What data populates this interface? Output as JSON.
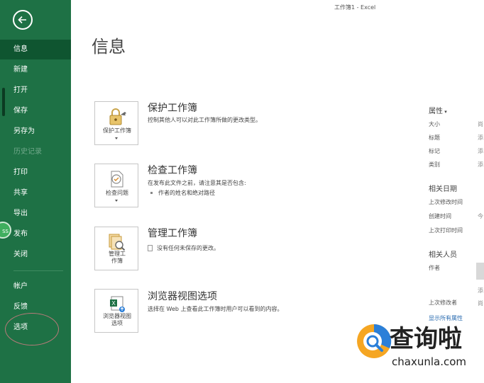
{
  "window": {
    "title": "工作簿1 - Excel"
  },
  "sidebar": {
    "items": [
      {
        "label": "信息"
      },
      {
        "label": "新建"
      },
      {
        "label": "打开"
      },
      {
        "label": "保存"
      },
      {
        "label": "另存为"
      },
      {
        "label": "历史记录"
      },
      {
        "label": "打印"
      },
      {
        "label": "共享"
      },
      {
        "label": "导出"
      },
      {
        "label": "发布"
      },
      {
        "label": "关闭"
      },
      {
        "label": "帐户"
      },
      {
        "label": "反馈"
      },
      {
        "label": "选项"
      }
    ],
    "selected": "信息",
    "disabled": "历史记录",
    "badge_text": "SS"
  },
  "page": {
    "title": "信息"
  },
  "sections": {
    "protect": {
      "button": "保护工作簿",
      "title": "保护工作簿",
      "desc": "控制其他人可以对此工作簿所做的更改类型。"
    },
    "inspect": {
      "button": "检查问题",
      "title": "检查工作簿",
      "desc": "在发布此文件之前，请注意其是否包含:",
      "bullet": "作者的姓名和绝对路径"
    },
    "manage": {
      "button_line1": "管理工",
      "button_line2": "作簿",
      "title": "管理工作簿",
      "desc": "没有任何未保存的更改。"
    },
    "browser": {
      "button_line1": "浏览器视图",
      "button_line2": "选项",
      "title": "浏览器视图选项",
      "desc": "选择在 Web 上查看此工作簿时用户可以看到的内容。"
    }
  },
  "properties": {
    "header": "属性",
    "rows": [
      {
        "label": "大小",
        "value": "尚"
      },
      {
        "label": "标题",
        "value": "添"
      },
      {
        "label": "标记",
        "value": "添"
      },
      {
        "label": "类别",
        "value": "添"
      }
    ],
    "dates_header": "相关日期",
    "dates": [
      {
        "label": "上次修改时间",
        "value": ""
      },
      {
        "label": "创建时间",
        "value": "今"
      },
      {
        "label": "上次打印时间",
        "value": ""
      }
    ],
    "people_header": "相关人员",
    "author_label": "作者",
    "author_value": "添",
    "author_value2": "尚",
    "modifier_label": "上次修改者",
    "show_all": "显示所有属性"
  },
  "watermark": {
    "brand": "查询啦",
    "url": "chaxunla.com"
  },
  "colors": {
    "sidebar": "#1e7145",
    "sidebar_selected": "#0f5530",
    "accent_blue": "#2b7fd8",
    "accent_orange": "#f5a623"
  }
}
